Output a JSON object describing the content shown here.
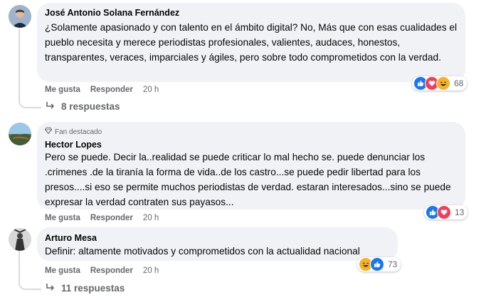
{
  "comments": [
    {
      "author": "José Antonio Solana Fernández",
      "text": "¿Solamente apasionado y con talento en el ámbito digital? No, Más que con esas cualidades el pueblo necesita y merece periodistas profesionales, valientes, audaces, honestos, transparentes, veraces, imparciales y ágiles, pero sobre todo comprometidos con la verdad.",
      "like_label": "Me gusta",
      "reply_label": "Responder",
      "time": "20 h",
      "reaction_icons": [
        "like-icon",
        "love-icon",
        "haha-icon"
      ],
      "reaction_count": "68",
      "replies_label": "8 respuestas"
    },
    {
      "badge": "Fan destacado",
      "author": "Hector Lopes",
      "text": "Pero se puede. Decir la..realidad se puede criticar lo mal hecho se. puede denunciar los .crimenes .de la tiranía la forma de vida..de los castro...se puede pedir libertad para los presos....si eso se permite muchos periodistas de verdad. estaran interesados...sino se puede expresar la verdad contraten sus payasos...",
      "like_label": "Me gusta",
      "reply_label": "Responder",
      "time": "20 h",
      "reaction_icons": [
        "like-icon",
        "love-icon"
      ],
      "reaction_count": "13"
    },
    {
      "author": "Arturo Mesa",
      "text": "Definir: altamente motivados y comprometidos con la actualidad nacional",
      "like_label": "Me gusta",
      "reply_label": "Responder",
      "time": "20 h",
      "reaction_icons": [
        "haha-icon",
        "like-icon"
      ],
      "reaction_count": "73",
      "replies_label": "11 respuestas"
    }
  ],
  "colors": {
    "bubble": "#f0f2f5",
    "like": "#1877f2",
    "love": "#f33e58",
    "haha": "#f7b125",
    "secondary_text": "#65676b"
  }
}
